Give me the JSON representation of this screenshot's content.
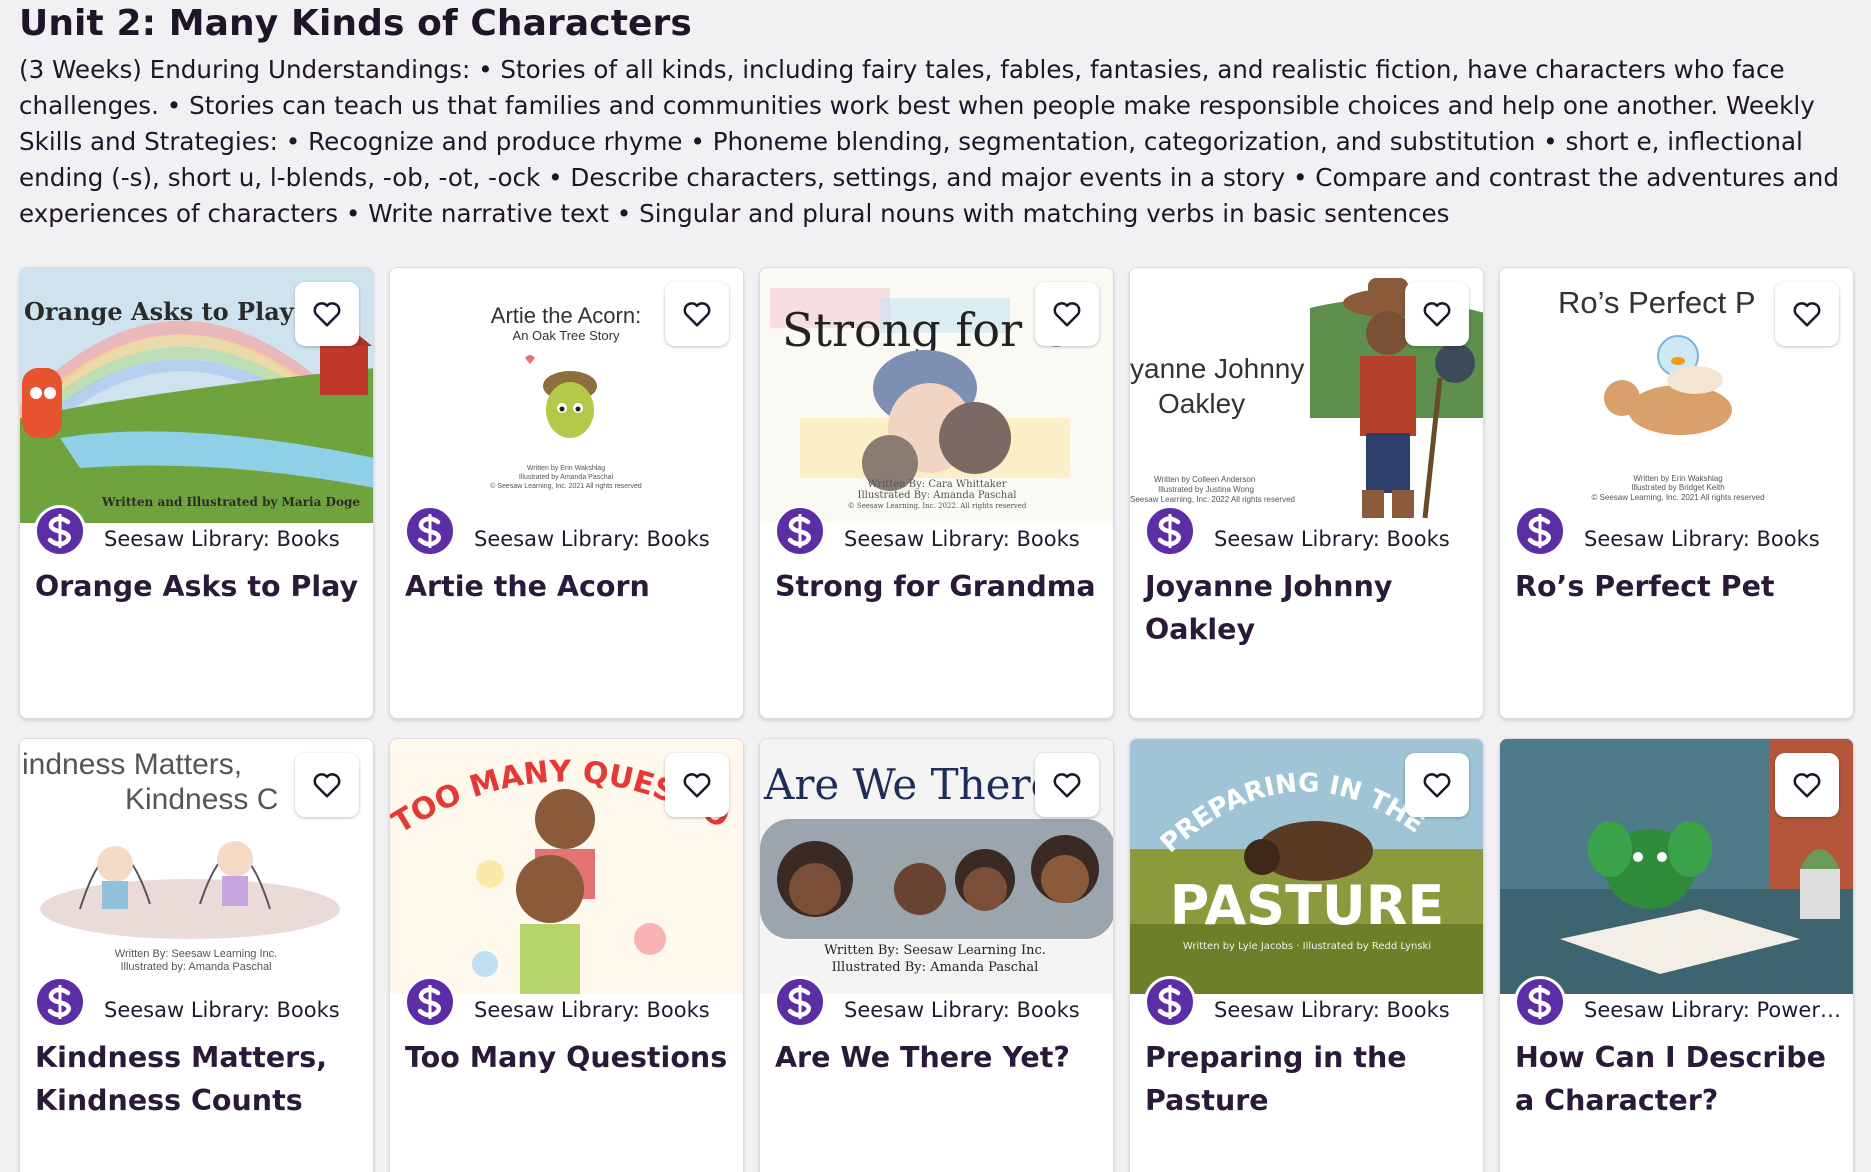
{
  "unit": {
    "title": "Unit 2: Many Kinds of Characters",
    "description": "(3 Weeks) Enduring Understandings: • Stories of all kinds, including fairy tales, fables, fantasies, and realistic fiction, have characters who face challenges. • Stories can teach us that families and communities work best when people make responsible choices and help one another. Weekly Skills and Strategies: • Recognize and produce rhyme • Phoneme blending, segmentation, categorization, and substitution • short e, inflectional ending (-s), short u, l-blends, -ob, -ot, -ock • Describe characters, settings, and major events in a story • Compare and contrast the adventures and experiences of characters • Write narrative text • Singular and plural nouns with matching verbs in basic sentences"
  },
  "cards": [
    {
      "title": "Orange Asks to Play",
      "source": "Seesaw Library: Books",
      "cover_text": [
        "Orange Asks to Play",
        "Written and Illustrated by Maria Doge"
      ]
    },
    {
      "title": "Artie the Acorn",
      "source": "Seesaw Library: Books",
      "cover_text": [
        "Artie the Acorn:",
        "An Oak Tree Story",
        "Written by Erin Wakshlag",
        "Illustrated by Amanda Paschal",
        "© Seesaw Learning, Inc. 2021 All rights reserved"
      ]
    },
    {
      "title": "Strong for Grandma",
      "source": "Seesaw Library: Books",
      "cover_text": [
        "Strong for Gr",
        "Written By: Cara Whittaker",
        "Illustrated By: Amanda Paschal",
        "© Seesaw Learning, Inc. 2022. All rights reserved"
      ]
    },
    {
      "title": "Joyanne Johnny Oakley",
      "source": "Seesaw Library: Books",
      "cover_text": [
        "yanne Johnny",
        "Oakley",
        "Written by Colleen Anderson",
        "Illustrated by Justina Wong",
        "Seesaw Learning, Inc. 2022 All rights reserved"
      ]
    },
    {
      "title": "Ro’s Perfect Pet",
      "source": "Seesaw Library: Books",
      "cover_text": [
        "Ro’s Perfect P",
        "Written by Erin Wakshlag",
        "Illustrated by Bridget Keith",
        "© Seesaw Learning, Inc. 2021 All rights reserved"
      ]
    },
    {
      "title": "Kindness Matters, Kindness Counts",
      "source": "Seesaw Library: Books",
      "cover_text": [
        "indness Matters,",
        "Kindness C",
        "Written By: Seesaw Learning Inc.",
        "Illustrated by: Amanda Paschal"
      ]
    },
    {
      "title": "Too Many Questions",
      "source": "Seesaw Library: Books",
      "cover_text": [
        "TOO MANY QUESTIONS!"
      ]
    },
    {
      "title": "Are We There Yet?",
      "source": "Seesaw Library: Books",
      "cover_text": [
        "Are We There",
        "Written By: Seesaw Learning Inc.",
        "Illustrated By: Amanda Paschal"
      ]
    },
    {
      "title": "Preparing in the Pasture",
      "source": "Seesaw Library: Books",
      "cover_text": [
        "PREPARING IN THE",
        "PASTURE",
        "Written by Lyle Jacobs · Illustrated by Redd Lynski"
      ]
    },
    {
      "title": "How Can I Describe a Character?",
      "source": "Seesaw Library: Power…",
      "cover_text": []
    }
  ],
  "icons": {
    "favorite": "heart-outline-icon",
    "logo": "seesaw-logo-icon"
  },
  "colors": {
    "logo_bg": "#5b2ea6",
    "title_text": "#2a1a3a"
  }
}
